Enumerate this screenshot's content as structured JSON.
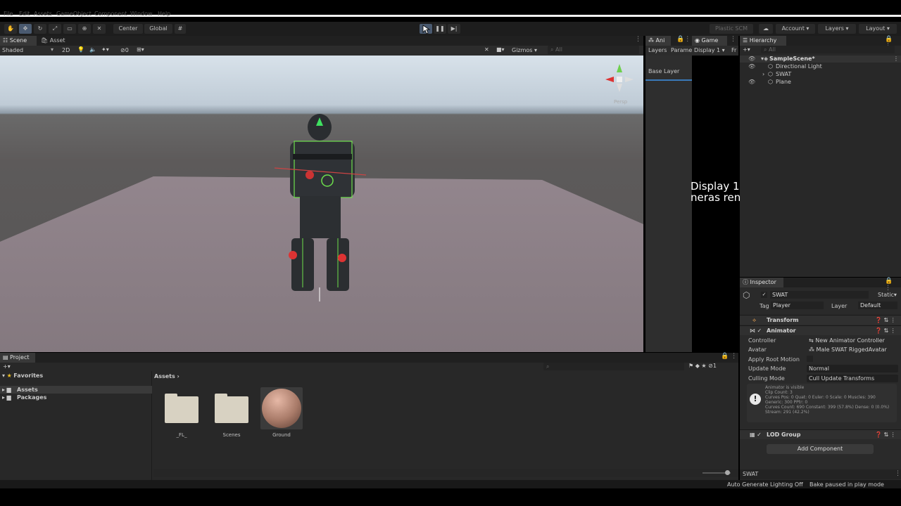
{
  "menu": [
    "File",
    "Edit",
    "Assets",
    "GameObject",
    "Component",
    "Window",
    "Help"
  ],
  "toolbar": {
    "center_label": "Center",
    "global_label": "Global",
    "plastic_label": "Plastic SCM",
    "account_label": "Account",
    "layers_label": "Layers",
    "layout_label": "Layout"
  },
  "scene": {
    "tabs": [
      "Scene",
      "Asset Store"
    ],
    "shading": "Shaded",
    "mode_2d": "2D",
    "hidden_count": "0",
    "gizmos_label": "Gizmos",
    "search_placeholder": "All",
    "persp_label": "Persp"
  },
  "animator": {
    "tab": "Ani",
    "subtabs": [
      "Layers",
      "Parame"
    ],
    "base_layer": "Base Layer"
  },
  "game": {
    "tab": "Game",
    "display": "Display 1",
    "free_label": "Fr",
    "overlay_line1": "Display 1",
    "overlay_line2": "neras ren"
  },
  "hierarchy": {
    "title": "Hierarchy",
    "search_placeholder": "All",
    "items": [
      "SampleScene*",
      "Directional Light",
      "SWAT",
      "Plane"
    ]
  },
  "inspector": {
    "title": "Inspector",
    "object_name": "SWAT",
    "static_label": "Static",
    "tag_label": "Tag",
    "tag_value": "Player",
    "layer_label": "Layer",
    "layer_value": "Default",
    "transform_label": "Transform",
    "animator_label": "Animator",
    "fields": [
      {
        "label": "Controller",
        "value": "New Animator Controller"
      },
      {
        "label": "Avatar",
        "value": "Male SWAT RiggedAvatar"
      },
      {
        "label": "Apply Root Motion",
        "value": ""
      },
      {
        "label": "Update Mode",
        "value": "Normal"
      },
      {
        "label": "Culling Mode",
        "value": "Cull Update Transforms"
      }
    ],
    "info_lines": [
      "Animator is visible",
      "Clip Count: 3",
      "Curves Pos: 0 Quat: 0 Euler: 0 Scale: 0 Muscles: 390",
      "Generic: 300 PPtr: 0",
      "Curves Count: 690 Constant: 399 (57.8%) Dense: 0 (0.0%)",
      "Stream: 291 (42.2%)"
    ],
    "lod_label": "LOD Group",
    "add_component": "Add Component",
    "footer_name": "SWAT"
  },
  "project": {
    "title": "Project",
    "favorites": "Favorites",
    "tree": [
      "Assets",
      "Packages"
    ],
    "breadcrumb": "Assets",
    "assets": [
      {
        "name": "_FL_",
        "kind": "folder"
      },
      {
        "name": "Scenes",
        "kind": "folder"
      },
      {
        "name": "Ground",
        "kind": "material"
      }
    ],
    "hidden_count": "1"
  },
  "status": {
    "lighting": "Auto Generate Lighting Off",
    "bake": "Bake paused in play mode"
  },
  "colors": {
    "accent": "#4a5a70",
    "panel": "#282828",
    "sky": "#d8e2ea",
    "ground": "#8b7f86"
  }
}
